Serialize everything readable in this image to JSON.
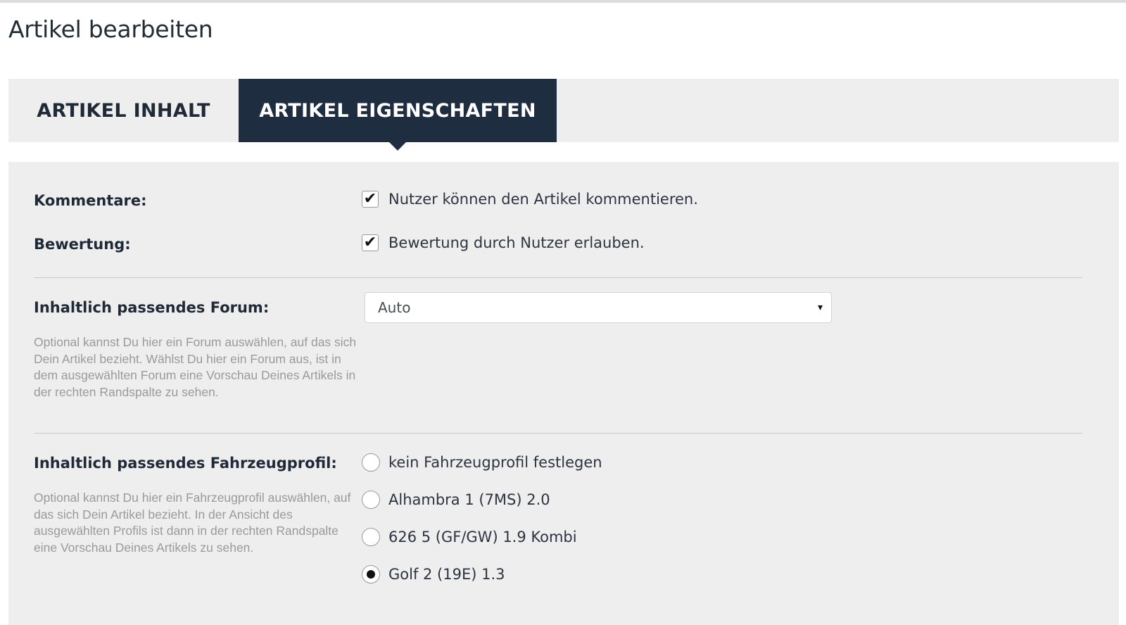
{
  "page": {
    "title": "Artikel bearbeiten"
  },
  "tabs": [
    {
      "label": "ARTIKEL INHALT",
      "active": false
    },
    {
      "label": "ARTIKEL EIGENSCHAFTEN",
      "active": true
    }
  ],
  "colors": {
    "tab_active_bg": "#1e2d40",
    "panel_bg": "#eeeeee",
    "help_text": "#9a9a9a"
  },
  "settings": {
    "comments": {
      "label": "Kommentare:",
      "option": "Nutzer können den Artikel kommentieren.",
      "checked": true
    },
    "rating": {
      "label": "Bewertung:",
      "option": "Bewertung durch Nutzer erlauben.",
      "checked": true
    },
    "forum": {
      "label": "Inhaltlich passendes Forum:",
      "help": "Optional kannst Du hier ein Forum auswählen, auf das sich Dein Artikel bezieht. Wählst Du hier ein Forum aus, ist in dem ausgewählten Forum eine Vorschau Deines Artikels in der rechten Randspalte zu sehen.",
      "selected": "Auto",
      "caret_icon": "▾"
    },
    "vehicle": {
      "label": "Inhaltlich passendes Fahrzeugprofil:",
      "help": "Optional kannst Du hier ein Fahrzeugprofil auswählen, auf das sich Dein Artikel bezieht. In der Ansicht des ausgewählten Profils ist dann in der rechten Randspalte eine Vorschau Deines Artikels zu sehen.",
      "options": [
        {
          "label": "kein Fahrzeugprofil festlegen",
          "checked": false
        },
        {
          "label": "Alhambra 1 (7MS) 2.0",
          "checked": false
        },
        {
          "label": "626 5 (GF/GW) 1.9 Kombi",
          "checked": false
        },
        {
          "label": "Golf 2 (19E) 1.3",
          "checked": true
        }
      ]
    }
  }
}
